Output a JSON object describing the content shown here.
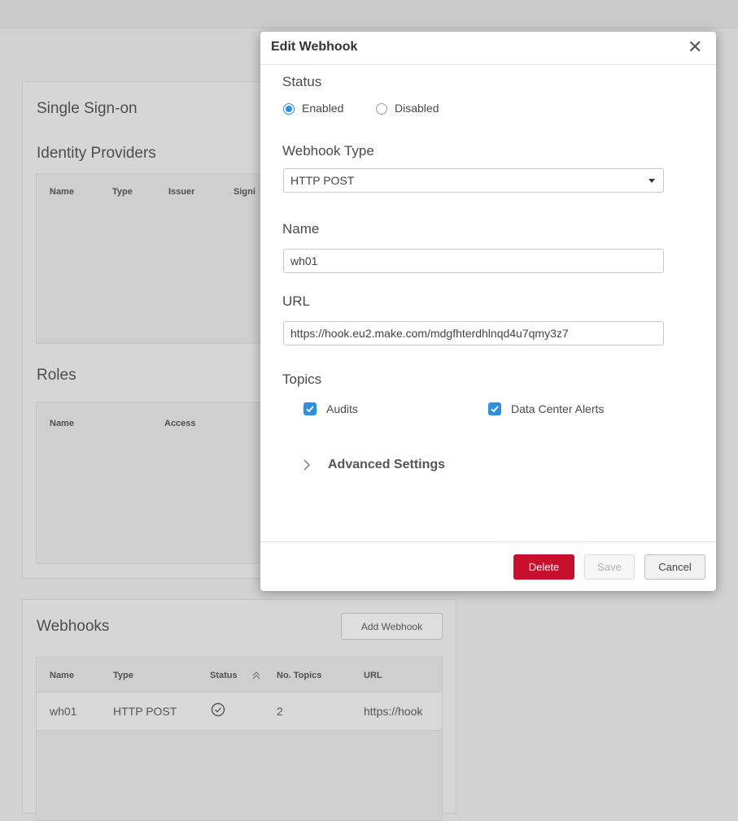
{
  "background": {
    "sso": {
      "title": "Single Sign-on",
      "idp_title": "Identity Providers",
      "idp_columns": [
        "Name",
        "Type",
        "Issuer",
        "Signi"
      ],
      "roles_title": "Roles",
      "roles_columns": [
        "Name",
        "Access"
      ]
    },
    "webhooks": {
      "title": "Webhooks",
      "add_button": "Add Webhook",
      "columns": {
        "name": "Name",
        "type": "Type",
        "status": "Status",
        "topics": "No. Topics",
        "url": "URL"
      },
      "rows": [
        {
          "name": "wh01",
          "type": "HTTP POST",
          "status_icon": "check-circle-icon",
          "topics": "2",
          "url": "https://hook"
        }
      ]
    }
  },
  "modal": {
    "title": "Edit Webhook",
    "close_icon": "close-icon",
    "status_label": "Status",
    "status_options": {
      "enabled": "Enabled",
      "disabled": "Disabled"
    },
    "status_selected": "Enabled",
    "type_label": "Webhook Type",
    "type_value": "HTTP POST",
    "name_label": "Name",
    "name_value": "wh01",
    "url_label": "URL",
    "url_value": "https://hook.eu2.make.com/mdgfhterdhlnqd4u7qmy3z7",
    "topics_label": "Topics",
    "topics": [
      {
        "label": "Audits",
        "checked": true
      },
      {
        "label": "Data Center Alerts",
        "checked": true
      }
    ],
    "advanced_label": "Advanced Settings",
    "buttons": {
      "delete": "Delete",
      "save": "Save",
      "cancel": "Cancel"
    }
  },
  "colors": {
    "accent": "#2d8fde",
    "danger": "#c8102e",
    "overlay_bg": "#d2d2d2"
  }
}
